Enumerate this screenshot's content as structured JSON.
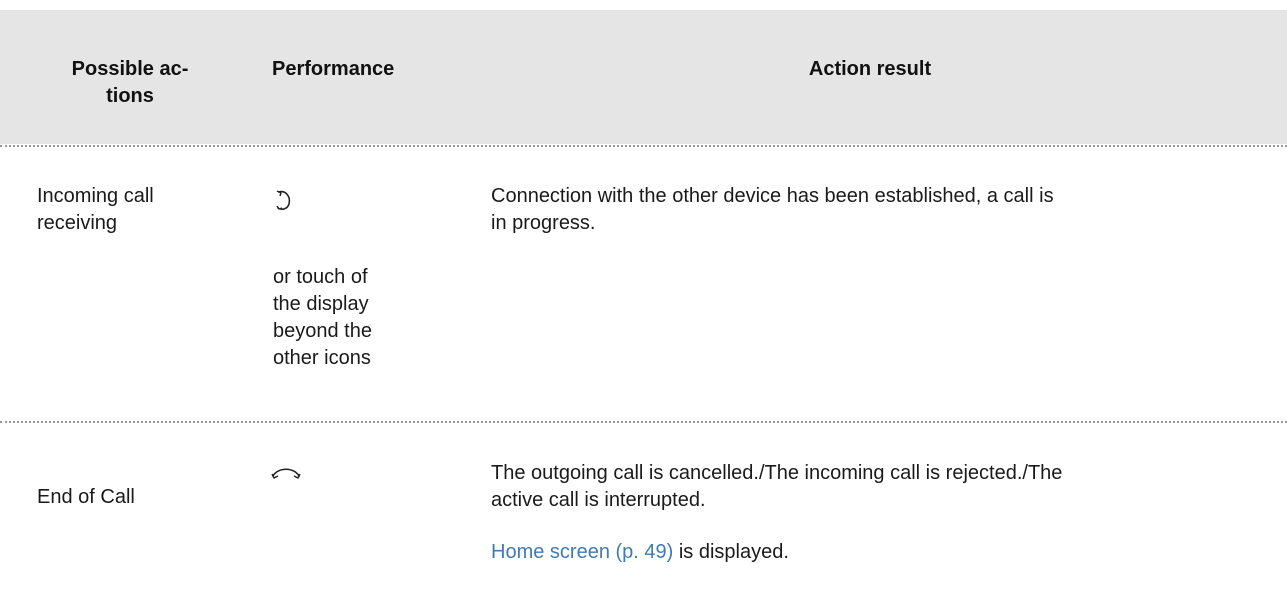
{
  "header": {
    "col1_line1": "Possible ac-",
    "col1_line2": "tions",
    "col2": "Performance",
    "col3": "Action result"
  },
  "rows": [
    {
      "action_line1": "Incoming call",
      "action_line2": "receiving",
      "icon": "phone-handset-pickup-icon",
      "performance_lines": [
        "or touch of",
        "the display",
        "beyond the",
        "other icons"
      ],
      "result_line1": "Connection with the other device has been established, a call is",
      "result_line2": "in progress."
    },
    {
      "action": "End of Call",
      "icon": "phone-hangup-icon",
      "result_line1": "The outgoing call is cancelled./The incoming call is rejected./The",
      "result_line2": "active call is interrupted.",
      "result_link": "Home screen (p. 49)",
      "result_link_suffix": " is displayed."
    }
  ],
  "colors": {
    "header_bg": "#e5e5e5",
    "link": "#3f7bb4",
    "divider": "#9a9a9a"
  }
}
